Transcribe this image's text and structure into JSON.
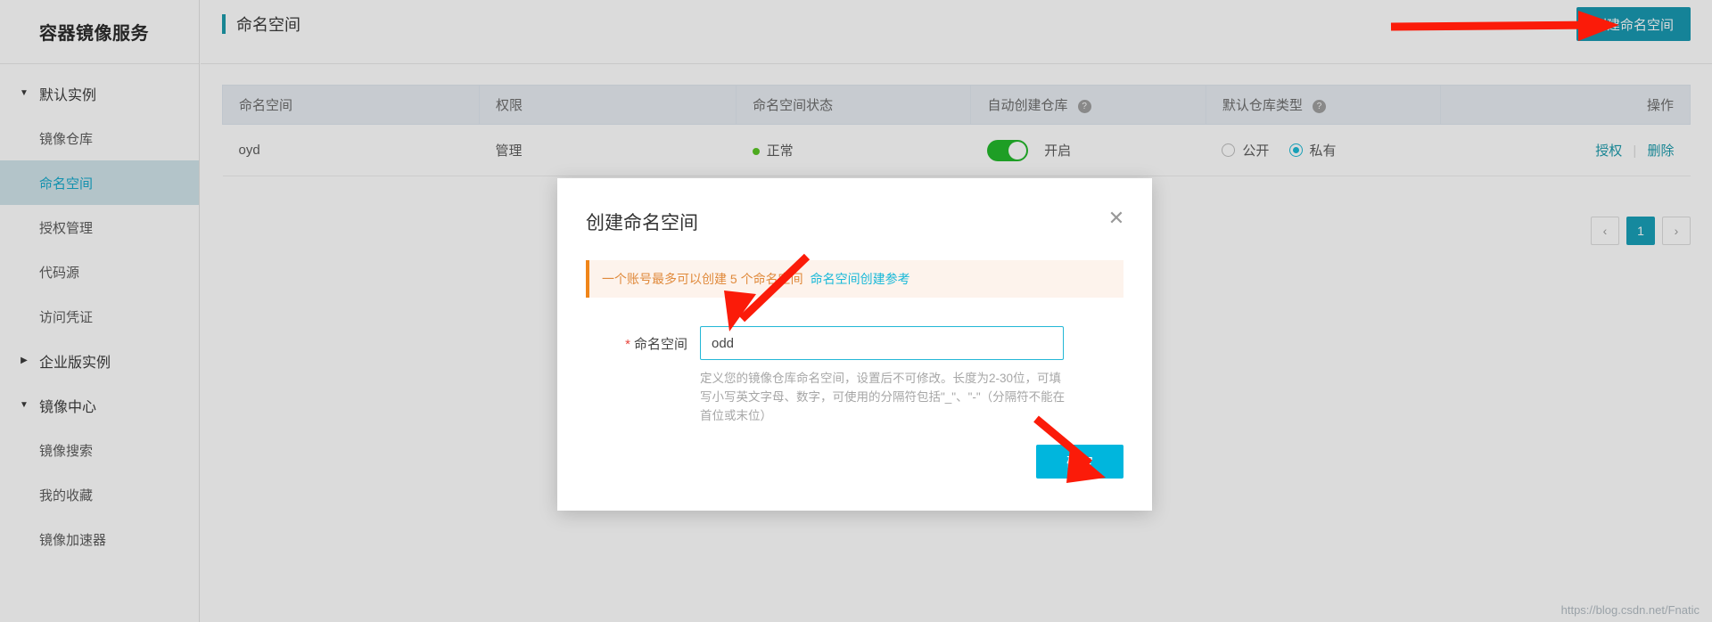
{
  "brand": {
    "title": "容器镜像服务"
  },
  "sidebar": {
    "groups": [
      {
        "label": "默认实例",
        "expanded": true,
        "items": [
          {
            "label": "镜像仓库",
            "active": false
          },
          {
            "label": "命名空间",
            "active": true
          },
          {
            "label": "授权管理",
            "active": false
          },
          {
            "label": "代码源",
            "active": false
          },
          {
            "label": "访问凭证",
            "active": false
          }
        ]
      },
      {
        "label": "企业版实例",
        "expanded": false,
        "items": []
      },
      {
        "label": "镜像中心",
        "expanded": true,
        "items": [
          {
            "label": "镜像搜索",
            "active": false
          },
          {
            "label": "我的收藏",
            "active": false
          },
          {
            "label": "镜像加速器",
            "active": false
          }
        ]
      }
    ],
    "caret_expanded": "▼",
    "caret_collapsed": "▶"
  },
  "header": {
    "page_title": "命名空间",
    "create_button": "创建命名空间"
  },
  "table": {
    "columns": [
      {
        "label": "命名空间",
        "help": false
      },
      {
        "label": "权限",
        "help": false
      },
      {
        "label": "命名空间状态",
        "help": false
      },
      {
        "label": "自动创建仓库",
        "help": true
      },
      {
        "label": "默认仓库类型",
        "help": true
      },
      {
        "label": "操作",
        "help": false
      }
    ],
    "help_glyph": "?",
    "rows": [
      {
        "namespace": "oyd",
        "permission": "管理",
        "status": "正常",
        "status_color": "#52c41a",
        "auto_create_repo": {
          "on": true,
          "label": "开启"
        },
        "default_repo_type": {
          "options": [
            {
              "label": "公开",
              "checked": false
            },
            {
              "label": "私有",
              "checked": true
            }
          ]
        },
        "actions": [
          "授权",
          "删除"
        ],
        "action_separator": "|"
      }
    ]
  },
  "pagination": {
    "prev": "‹",
    "next": "›",
    "pages": [
      "1"
    ],
    "current": "1"
  },
  "modal": {
    "title": "创建命名空间",
    "close_glyph": "✕",
    "alert": {
      "text": "一个账号最多可以创建 5 个命名空间",
      "link": "命名空间创建参考"
    },
    "form": {
      "required_mark": "*",
      "label": "命名空间",
      "value": "odd",
      "placeholder": "",
      "help": "定义您的镜像仓库命名空间，设置后不可修改。长度为2-30位，可填写小写英文字母、数字，可使用的分隔符包括\"_\"、\"-\"（分隔符不能在首位或末位）"
    },
    "confirm_button": "确定"
  },
  "watermark": {
    "text": "https://blog.csdn.net/Fnatic"
  },
  "colors": {
    "accent": "#0e94ae",
    "confirm": "#00b6dd",
    "active_nav_bg": "#cfe3ea",
    "active_nav_text": "#0aa5c8",
    "switch_on": "#19b521",
    "alert_bar": "#f08519",
    "arrow": "#fb1b09"
  }
}
